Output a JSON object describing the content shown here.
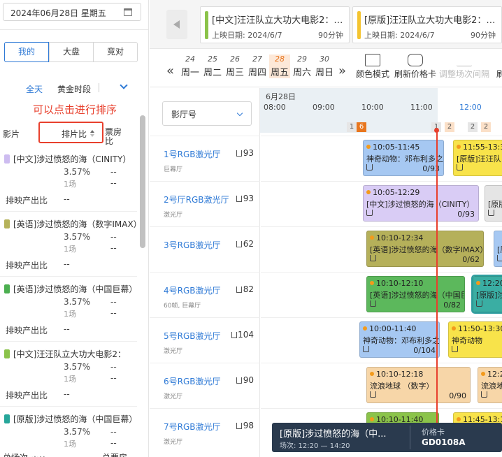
{
  "sidebar": {
    "date": "2024年06月28日 星期五",
    "tabs": [
      "我的",
      "大盘",
      "竞对"
    ],
    "filters": {
      "all_day": "全天",
      "golden": "黄金时段"
    },
    "sort_hint": "可以点击进行排序",
    "headers": {
      "film": "影片",
      "ratio": "排片比",
      "box_office": "票房比"
    },
    "output_label": "排映产出比",
    "dash": "--",
    "movies": [
      {
        "name": "[中文]涉过愤怒的海（CINITY）",
        "ratio": "3.57%",
        "sessions": "1场",
        "color": "#cdbcf0"
      },
      {
        "name": "[英语]涉过愤怒的海（数字IMAX）",
        "ratio": "3.57%",
        "sessions": "1场",
        "color": "#b5b25a"
      },
      {
        "name": "[英语]涉过愤怒的海（中国巨幕）",
        "ratio": "3.57%",
        "sessions": "1场",
        "color": "#4caf50"
      },
      {
        "name": "[中文]汪汪队立大功大电影2：",
        "ratio": "3.57%",
        "sessions": "1场",
        "color": "#8bc34a"
      },
      {
        "name": "[原版]涉过愤怒的海（中国巨幕）",
        "ratio": "3.57%",
        "sessions": "1场",
        "color": "#26a69a"
      }
    ],
    "footer": {
      "total_sessions": "总场次",
      "total_tickets": "总票房"
    }
  },
  "top_movies": [
    {
      "title": "[中文]汪汪队立大功大电影2：…",
      "release": "上映日期: 2024/6/7",
      "duration": "90分钟",
      "color": "#8bc34a"
    },
    {
      "title": "[原版]汪汪队立大功大电影2：…",
      "release": "上映日期: 2024/6/7",
      "duration": "90分钟",
      "color": "#f4c430"
    }
  ],
  "days": [
    {
      "n": "24",
      "w": "周一"
    },
    {
      "n": "25",
      "w": "周二"
    },
    {
      "n": "26",
      "w": "周三"
    },
    {
      "n": "27",
      "w": "周四"
    },
    {
      "n": "28",
      "w": "周五"
    },
    {
      "n": "29",
      "w": "周六"
    },
    {
      "n": "30",
      "w": "周日"
    }
  ],
  "tools": {
    "color_mode": "颜色模式",
    "refresh_card": "刷新价格卡",
    "adjust_interval": "调整场次间隔",
    "more": "刷"
  },
  "timeline": {
    "date": "6月28日",
    "ticks": [
      "08:00",
      "09:00",
      "10:00",
      "11:00",
      "12:00"
    ],
    "counts": [
      "1",
      "6",
      "1",
      "2",
      "2",
      "2"
    ]
  },
  "hall_select": "影厅号",
  "halls": [
    {
      "name": "1号RGB激光厅",
      "seats": "93",
      "tag": "巨幕厅"
    },
    {
      "name": "2号厅RGB激光厅",
      "seats": "93",
      "tag": "激光厅"
    },
    {
      "name": "3号RGB激光厅",
      "seats": "62",
      "tag": ""
    },
    {
      "name": "4号RGB激光厅",
      "seats": "82",
      "tag": "60帧, 巨幕厅"
    },
    {
      "name": "5号RGB激光厅",
      "seats": "104",
      "tag": "激光厅"
    },
    {
      "name": "6号RGB激光厅",
      "seats": "90",
      "tag": "激光厅"
    },
    {
      "name": "7号RGB激光厅",
      "seats": "98",
      "tag": "激光厅"
    }
  ],
  "blocks": [
    {
      "time": "10:05-11:45",
      "name": "神奇动物：邓布利多之谜",
      "sold": "0/93",
      "color": "#a6c8f2"
    },
    {
      "time": "11:55-13:35",
      "name": "[原版]汪汪队",
      "sold": "",
      "color": "#f8e34a"
    },
    {
      "time": "10:05-12:29",
      "name": "[中文]涉过愤怒的海（CINITY）",
      "sold": "0/93",
      "color": "#d9ccf5"
    },
    {
      "time": "",
      "name": "[原版",
      "sold": "",
      "color": "#e5e5e5"
    },
    {
      "time": "10:10-12:34",
      "name": "[英语]涉过愤怒的海（数字IMAX）",
      "sold": "0/62",
      "color": "#b5b05a"
    },
    {
      "time": "",
      "name": "[原",
      "sold": "",
      "color": "#a6c8f2"
    },
    {
      "time": "10:10-12:10",
      "name": "[英语]涉过愤怒的海（中国巨幕）",
      "sold": "0/82",
      "color": "#5cb85c"
    },
    {
      "time": "12:20",
      "name": "[原版]涉",
      "sold": "",
      "color": "#3aaea3"
    },
    {
      "time": "10:00-11:40",
      "name": "神奇动物：邓布利多之谜",
      "sold": "0/104",
      "color": "#a6c8f2"
    },
    {
      "time": "11:50-13:30",
      "name": "神奇动物",
      "sold": "",
      "color": "#f8e34a"
    },
    {
      "time": "10:10-12:18",
      "name": "流浪地球 （数字）",
      "sold": "0/90",
      "color": "#f7d6a8"
    },
    {
      "time": "12:2",
      "name": "流浪地",
      "sold": "",
      "color": "#f7d6a8"
    },
    {
      "time": "10:10-11:40",
      "name": "",
      "sold": "",
      "color": "#8bc34a"
    },
    {
      "time": "11:45-13:15",
      "name": "",
      "sold": "",
      "color": "#f8e34a"
    }
  ],
  "tooltip": {
    "title": "[原版]涉过愤怒的海（中...",
    "sub": "场次: 12:20 — 14:20",
    "price_label": "价格卡",
    "price_value": "GD0108A"
  }
}
